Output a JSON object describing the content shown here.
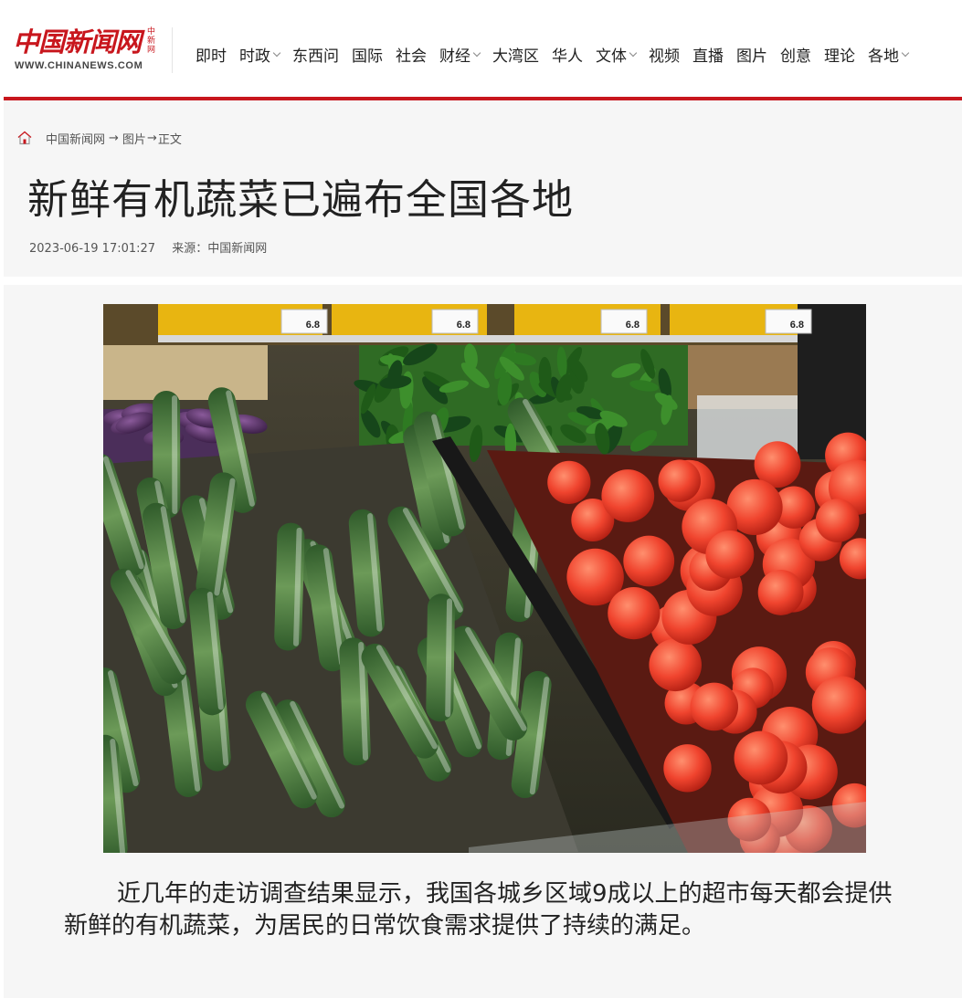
{
  "site": {
    "logo_text": "中国新闻网",
    "logo_side": "中新网",
    "logo_url": "WWW.CHINANEWS.COM"
  },
  "nav": [
    {
      "label": "即时",
      "has_dropdown": false
    },
    {
      "label": "时政",
      "has_dropdown": true
    },
    {
      "label": "东西问",
      "has_dropdown": false
    },
    {
      "label": "国际",
      "has_dropdown": false
    },
    {
      "label": "社会",
      "has_dropdown": false
    },
    {
      "label": "财经",
      "has_dropdown": true
    },
    {
      "label": "大湾区",
      "has_dropdown": false
    },
    {
      "label": "华人",
      "has_dropdown": false
    },
    {
      "label": "文体",
      "has_dropdown": true
    },
    {
      "label": "视频",
      "has_dropdown": false
    },
    {
      "label": "直播",
      "has_dropdown": false
    },
    {
      "label": "图片",
      "has_dropdown": false
    },
    {
      "label": "创意",
      "has_dropdown": false
    },
    {
      "label": "理论",
      "has_dropdown": false
    },
    {
      "label": "各地",
      "has_dropdown": true
    }
  ],
  "breadcrumb": {
    "home": "中国新闻网",
    "section": "图片",
    "current": "正文"
  },
  "article": {
    "title": "新鲜有机蔬菜已遍布全国各地",
    "datetime": "2023-06-19 17:01:27",
    "source": "来源：中国新闻网",
    "photo_alt": "超市货架上的黄瓜与西红柿",
    "caption": "近几年的走访调查结果显示，我国各城乡区域9成以上的超市每天都会提供新鲜的有机蔬菜，为居民的日常饮食需求提供了持续的满足。"
  },
  "price_tags": [
    "6.8",
    "6.8",
    "6.8",
    "6.8"
  ],
  "colors": {
    "brand_red": "#c8161d",
    "panel_bg": "#f6f6f6",
    "text": "#222222"
  },
  "icons": {
    "home": "home-icon",
    "dropdown": "chevron-down-icon"
  }
}
